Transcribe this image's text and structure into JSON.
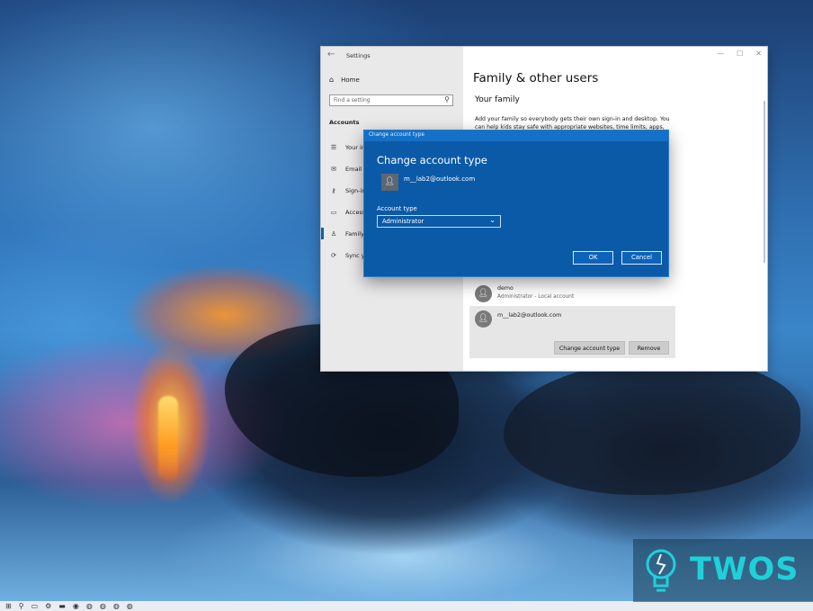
{
  "settings": {
    "app_title": "Settings",
    "back_icon": "back-arrow-icon",
    "controls": [
      "—",
      "☐",
      "✕"
    ],
    "nav": {
      "home_label": "Home",
      "search_placeholder": "Find a setting",
      "section_label": "Accounts",
      "items": [
        {
          "label": "Your info",
          "icon": "person-card-icon"
        },
        {
          "label": "Email &",
          "icon": "mail-icon"
        },
        {
          "label": "Sign-in o",
          "icon": "key-icon"
        },
        {
          "label": "Access w",
          "icon": "briefcase-icon"
        },
        {
          "label": "Family &",
          "icon": "family-icon",
          "active": true
        },
        {
          "label": "Sync you",
          "icon": "sync-icon"
        }
      ]
    },
    "content": {
      "page_title": "Family & other users",
      "section_title": "Your family",
      "description": "Add your family so everybody gets their own sign-in and desktop. You can help kids stay safe with appropriate websites, time limits, apps, and",
      "users": [
        {
          "name": "demo",
          "subtitle": "Administrator - Local account"
        },
        {
          "name": "m__lab2@outlook.com",
          "subtitle": ""
        }
      ],
      "change_button": "Change account type",
      "remove_button": "Remove"
    }
  },
  "dialog": {
    "window_title": "Change account type",
    "heading": "Change account type",
    "email": "m__lab2@outlook.com",
    "account_type_label": "Account type",
    "account_type_value": "Administrator",
    "ok_label": "OK",
    "cancel_label": "Cancel"
  },
  "watermark": {
    "text": "TWOS"
  },
  "colors": {
    "accent": "#0063b1",
    "dialog_bg": "#0b5aa8",
    "watermark_text": "#1fd0d8"
  }
}
